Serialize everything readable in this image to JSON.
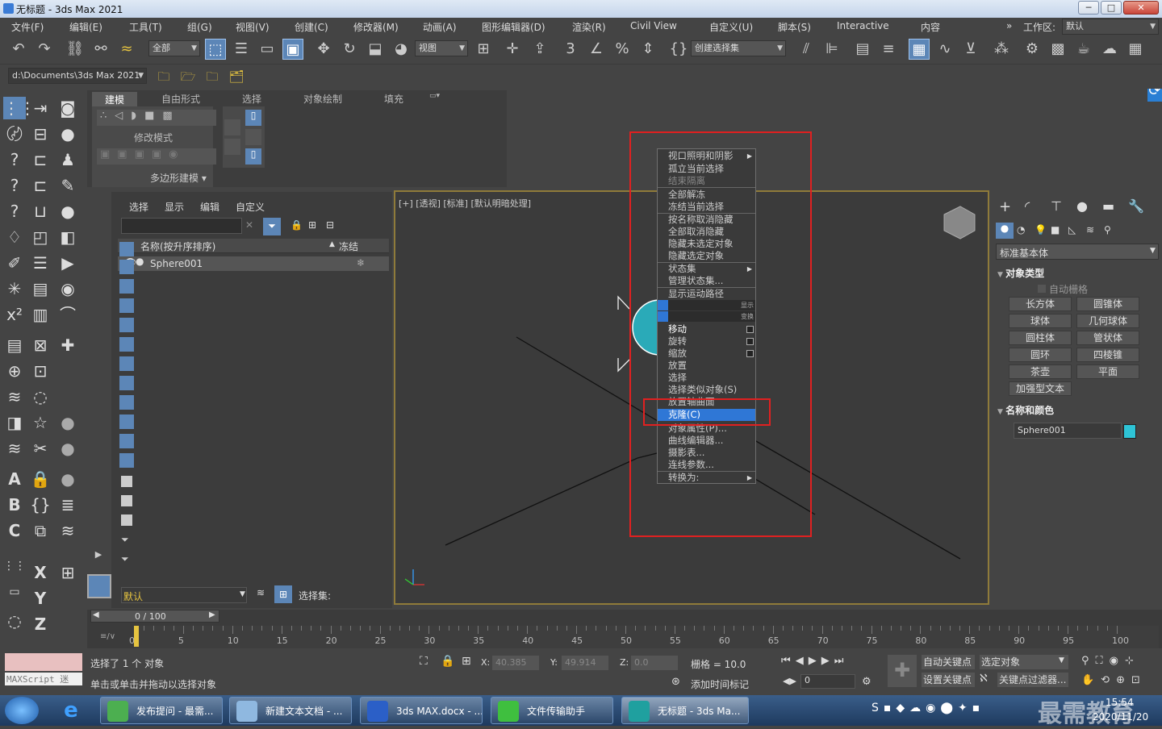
{
  "window": {
    "title": "无标题 - 3ds Max 2021",
    "min": "─",
    "max": "□",
    "close": "✕"
  },
  "menubar": {
    "items": [
      "文件(F)",
      "编辑(E)",
      "工具(T)",
      "组(G)",
      "视图(V)",
      "创建(C)",
      "修改器(M)",
      "动画(A)",
      "图形编辑器(D)",
      "渲染(R)",
      "Civil View",
      "自定义(U)",
      "脚本(S)",
      "Interactive",
      "内容"
    ],
    "overflow": "»",
    "workspace_label": "工作区:",
    "workspace_value": "默认"
  },
  "toolbar": {
    "filter_value": "全部",
    "refcoord_value": "视图",
    "selset_value": "创建选择集",
    "path_value": "d:\\Documents\\3ds Max 2021"
  },
  "ribbon": {
    "tabs": [
      "建模",
      "自由形式",
      "选择",
      "对象绘制",
      "填充"
    ],
    "mode_label": "修改模式",
    "poly_label": "多边形建模 ▾"
  },
  "scene_explorer": {
    "tabs": [
      "选择",
      "显示",
      "编辑",
      "自定义"
    ],
    "col_name": "名称(按升序排序)",
    "col_sort": "▲",
    "col_freeze": "冻结",
    "objects": [
      {
        "name": "Sphere001"
      }
    ],
    "layer_value": "默认",
    "selset_label": "选择集:"
  },
  "viewport": {
    "label": "[+] [透视] [标准] [默认明暗处理]"
  },
  "context_menu": {
    "section1": [
      {
        "label": "视口照明和阴影",
        "sub": true,
        "dim": false
      },
      {
        "label": "孤立当前选择",
        "dim": false
      },
      {
        "label": "结束隔离",
        "dim": true
      },
      {
        "label": "全部解冻",
        "dim": false
      },
      {
        "label": "冻结当前选择",
        "dim": false
      },
      {
        "label": "按名称取消隐藏",
        "dim": false
      },
      {
        "label": "全部取消隐藏",
        "dim": false
      },
      {
        "label": "隐藏未选定对象",
        "dim": false
      },
      {
        "label": "隐藏选定对象",
        "dim": false
      },
      {
        "label": "状态集",
        "sub": true,
        "dim": false
      },
      {
        "label": "管理状态集...",
        "dim": false
      },
      {
        "label": "显示运动路径",
        "dim": false
      }
    ],
    "header_display": "显示",
    "header_transform": "变换",
    "section2": [
      {
        "label": "移动",
        "box": true,
        "dim": false
      },
      {
        "label": "旋转",
        "box": true,
        "dim": false
      },
      {
        "label": "缩放",
        "box": true,
        "dim": false
      },
      {
        "label": "放置",
        "dim": false
      },
      {
        "label": "选择",
        "dim": false
      },
      {
        "label": "选择类似对象(S)",
        "dim": false
      },
      {
        "label": "放置轴曲面",
        "dim": false
      },
      {
        "label": "克隆(C)",
        "hl": true
      },
      {
        "label": "对象属性(P)...",
        "dim": false
      },
      {
        "label": "曲线编辑器...",
        "dim": false
      },
      {
        "label": "摄影表...",
        "dim": false
      },
      {
        "label": "连线参数...",
        "dim": false
      },
      {
        "label": "转换为:",
        "sub": true,
        "dim": false
      }
    ]
  },
  "command_panel": {
    "category_value": "标准基本体",
    "rollout_object_type": "对象类型",
    "autogrid_label": "自动栅格",
    "object_buttons": [
      "长方体",
      "圆锥体",
      "球体",
      "几何球体",
      "圆柱体",
      "管状体",
      "圆环",
      "四棱锥",
      "茶壶",
      "平面",
      "加强型文本"
    ],
    "rollout_name_color": "名称和颜色",
    "object_name": "Sphere001",
    "object_color": "#2ec4d6"
  },
  "timeline": {
    "frame_counter": "0 / 100",
    "ticks": [
      "0",
      "5",
      "10",
      "15",
      "20",
      "25",
      "30",
      "35",
      "40",
      "45",
      "50",
      "55",
      "60",
      "65",
      "70",
      "75",
      "80",
      "85",
      "90",
      "95",
      "100"
    ]
  },
  "status": {
    "maxscript_label": "MAXScript 迷",
    "selected_text": "选择了 1 个 对象",
    "prompt_text": "单击或单击并拖动以选择对象",
    "x_label": "X:",
    "x_value": "40.385",
    "y_label": "Y:",
    "y_value": "49.914",
    "z_label": "Z:",
    "z_value": "0.0",
    "grid_text": "栅格 = 10.0",
    "add_time_tag": "添加时间标记",
    "auto_key": "自动关键点",
    "set_key": "设置关键点",
    "selected_obj": "选定对象",
    "key_filter": "关键点过滤器...",
    "frame_value": "0"
  },
  "taskbar": {
    "tasks": [
      "发布提问 - 最需...",
      "新建文本文档 - ...",
      "3ds MAX.docx - ...",
      "文件传输助手",
      "无标题 - 3ds Ma..."
    ],
    "time": "15:54",
    "date": "2020/11/20",
    "watermark": "最需教育"
  }
}
